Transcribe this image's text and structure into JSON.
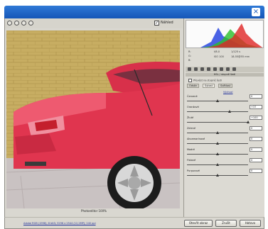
{
  "window": {
    "close_glyph": "×",
    "accent": "#1556b8"
  },
  "toolbar": {
    "tools": [
      "zoom-icon",
      "hand-icon",
      "rotate-left-icon",
      "rotate-right-icon"
    ],
    "preview_label": "Náhled",
    "preview_checked": true
  },
  "canvas": {
    "label": "Photoeditor 100%"
  },
  "panel": {
    "readouts": [
      "R:",
      "G:",
      "B:",
      "f/8.0",
      "1/125 s",
      "ISO 100",
      "18-55@55 mm"
    ],
    "section_title": "HSL / stupně šedi",
    "convert_label": "Převést na stupně šedi",
    "tabs": [
      "Odstín",
      "Sytost",
      "Světlost"
    ],
    "active_tab": "Sytost",
    "default_link": "Výchozí",
    "sliders": [
      {
        "label": "Červené",
        "value": "0",
        "level": 0.5
      },
      {
        "label": "Oranžové",
        "value": "+37",
        "level": 0.7
      },
      {
        "label": "Žluté",
        "value": "+100",
        "level": 1.0
      },
      {
        "label": "Zelené",
        "value": "0",
        "level": 0.5
      },
      {
        "label": "Akvamarínové",
        "value": "0",
        "level": 0.5
      },
      {
        "label": "Modré",
        "value": "0",
        "level": 0.5
      },
      {
        "label": "Fialové",
        "value": "0",
        "level": 0.5
      },
      {
        "label": "Purpurové",
        "value": "0",
        "level": 0.5
      }
    ]
  },
  "statusbar": {
    "file_info": "Adobe RGB (1998); 8 bitů; 3296 x 2544 (12,2MP); 240 ppi",
    "buttons": {
      "open": "Otevřít obraz",
      "cancel": "Zrušit",
      "done": "Hotovo"
    }
  }
}
